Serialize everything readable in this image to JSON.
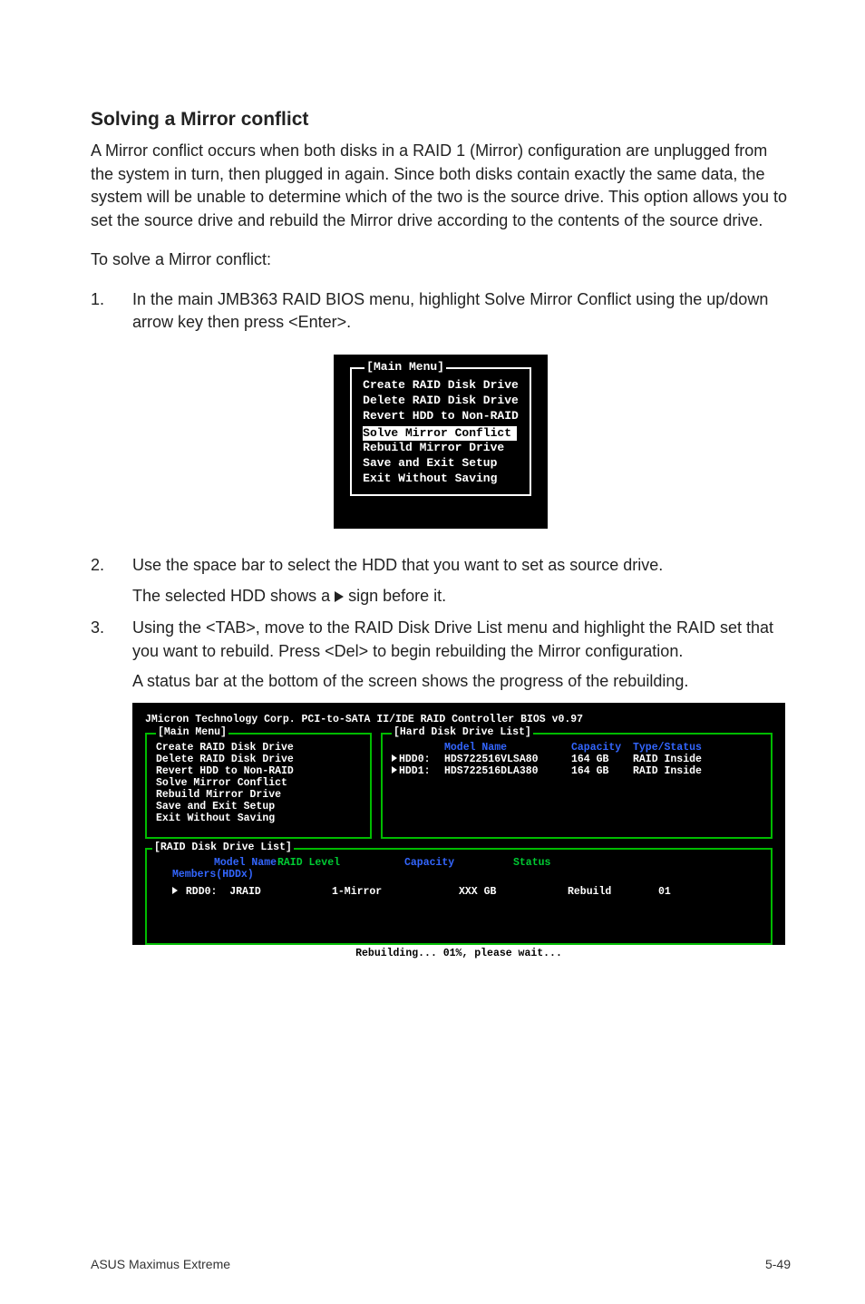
{
  "heading": "Solving a Mirror conflict",
  "intro": "A Mirror conflict occurs when both disks in a RAID 1 (Mirror) configuration are unplugged from the system in turn, then plugged in again. Since both disks contain exactly the same data, the system will be unable to determine which of the two is the source drive. This option allows you to set the source drive and rebuild the Mirror drive according to the contents of the source drive.",
  "lead": "To solve a Mirror conflict:",
  "steps": {
    "s1_num": "1.",
    "s1": "In the main JMB363 RAID BIOS menu, highlight Solve Mirror Conflict using the up/down arrow key then press <Enter>.",
    "s2_num": "2.",
    "s2": "Use the space bar to select the HDD that you want to set as source drive.",
    "s2_sub_a": "The selected HDD shows a ",
    "s2_sub_b": " sign before it.",
    "s3_num": "3.",
    "s3": "Using the <TAB>, move to the RAID Disk Drive List menu and highlight the RAID set that you want to rebuild. Press <Del> to begin rebuilding the Mirror configuration.",
    "s3_sub": "A status bar at the bottom of the screen shows the progress of the rebuilding."
  },
  "bios_small": {
    "title": "[Main Menu]",
    "items": [
      "Create RAID Disk Drive",
      "Delete RAID Disk Drive",
      "Revert HDD to Non-RAID",
      "Solve Mirror Conflict",
      "Rebuild Mirror Drive",
      "Save and Exit Setup",
      "Exit Without Saving"
    ]
  },
  "bios_large": {
    "header": "JMicron Technology Corp. PCI-to-SATA II/IDE RAID Controller BIOS v0.97",
    "main_title": "[Main Menu]",
    "hdd_title": "[Hard Disk Drive List]",
    "raid_title": "[RAID Disk Drive List]",
    "main_items": [
      "Create RAID Disk Drive",
      "Delete RAID Disk Drive",
      "Revert HDD to Non-RAID",
      "Solve Mirror Conflict",
      "Rebuild Mirror Drive",
      "Save and Exit Setup",
      "Exit Without Saving"
    ],
    "hdd_cols": {
      "model": "Model Name",
      "cap": "Capacity",
      "type": "Type/Status"
    },
    "hdd_rows": [
      {
        "slot": "HDD0:",
        "model": "HDS722516VLSA80",
        "cap": "164 GB",
        "type": "RAID Inside"
      },
      {
        "slot": "HDD1:",
        "model": "HDS722516DLA380",
        "cap": "164 GB",
        "type": "RAID Inside"
      }
    ],
    "raid_cols": {
      "model": "Model Name",
      "level": "RAID Level",
      "cap": "Capacity",
      "status": "Status"
    },
    "members_label": "Members(HDDx)",
    "raid_rows": [
      {
        "slot": "RDD0:",
        "name": "JRAID",
        "level": "1-Mirror",
        "cap": "XXX GB",
        "status": "Rebuild",
        "members": "01"
      }
    ],
    "status_bar": "Rebuilding... 01%, please wait..."
  },
  "footer": {
    "left": "ASUS Maximus Extreme",
    "right": "5-49"
  }
}
